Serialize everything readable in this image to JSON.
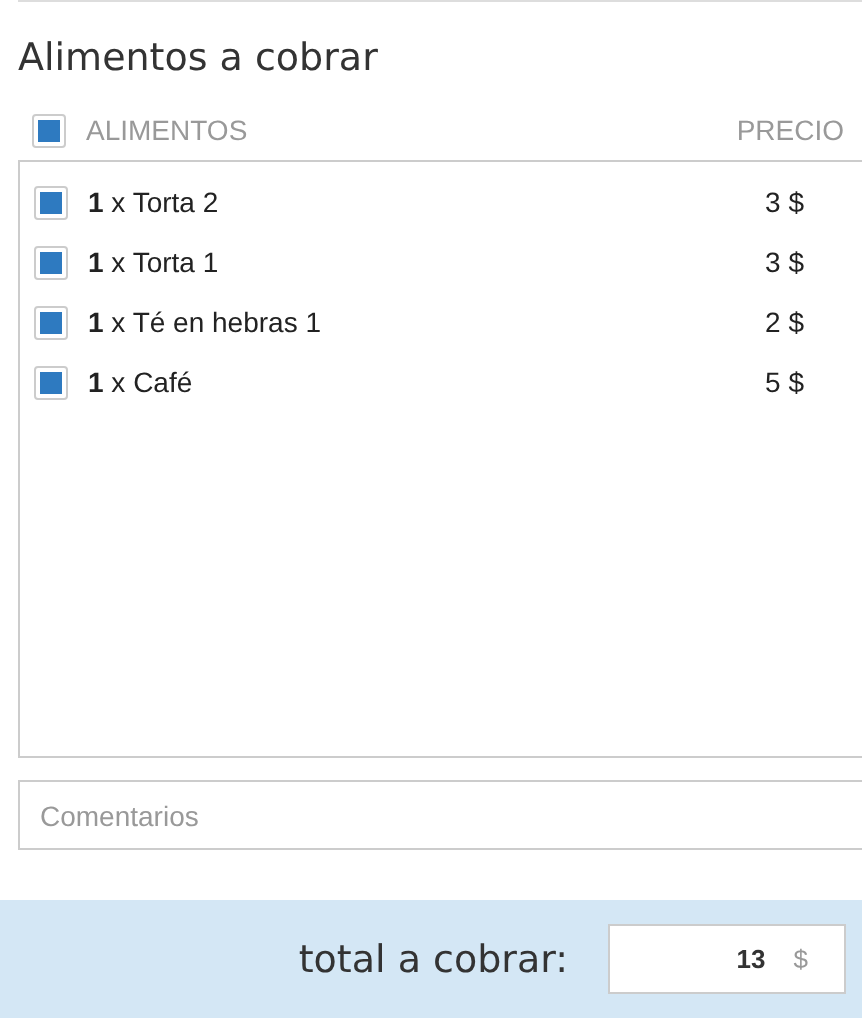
{
  "title": "Alimentos a cobrar",
  "header": {
    "checked": true,
    "columns": [
      "ALIMENTOS",
      "PRECIO"
    ]
  },
  "items": [
    {
      "label": "**1** x Torta 2",
      "price": "3 $",
      "checked": true
    },
    {
      "label": "**1** x Torta 1",
      "price": "3 $",
      "checked": true
    },
    {
      "label": "**1** x Té en hebras 1",
      "price": "2 $",
      "checked": true
    },
    {
      "label": "**1** x Café",
      "price": "5 $",
      "checked": true
    }
  ],
  "comments": {
    "placeholder": "Comentarios"
  },
  "total": {
    "label": "total a cobrar:",
    "value": "13",
    "unit": "$"
  }
}
